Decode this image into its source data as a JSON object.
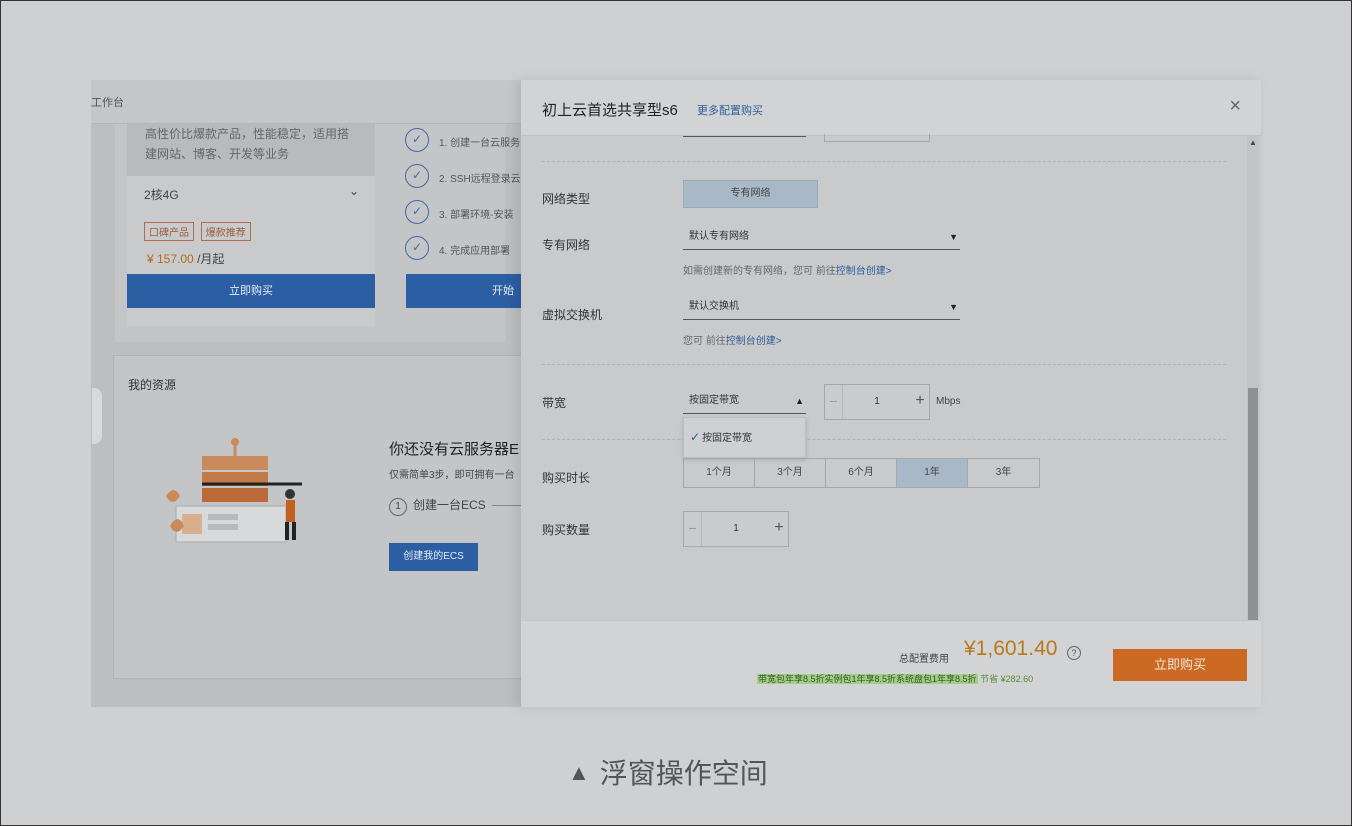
{
  "background": {
    "workspace_label": "工作台",
    "product": {
      "description_line1": "高性价比爆款产品，性能稳定，适用搭",
      "description_line2": "建网站、博客、开发等业务",
      "spec": "2核4G",
      "tags": [
        "口碑产品",
        "爆款推荐"
      ],
      "price": "¥ 157.00",
      "price_unit": "/月起",
      "buy_label": "立即购买"
    },
    "steps": [
      "1. 创建一台云服务",
      "2. SSH远程登录云",
      "3. 部署环境-安装",
      "4. 完成应用部署"
    ],
    "start_label": "开始",
    "resources": {
      "title": "我的资源",
      "empty_title": "你还没有云服务器E",
      "empty_sub": "仅需简单3步，即可拥有一台",
      "step1": "创建一台ECS",
      "step1_num": "1",
      "create_label": "创建我的ECS"
    }
  },
  "drawer": {
    "title": "初上云首选共享型s6",
    "more_link": "更多配置购买",
    "close_icon": "×",
    "network_type": {
      "label": "网络类型",
      "value": "专有网络"
    },
    "vpc": {
      "label": "专有网络",
      "value": "默认专有网络",
      "hint": "如需创建新的专有网络，您可 前往",
      "hint_link": "控制台创建>"
    },
    "vswitch": {
      "label": "虚拟交换机",
      "value": "默认交换机",
      "hint": "您可 前往",
      "hint_link": "控制台创建>"
    },
    "bandwidth": {
      "label": "带宽",
      "mode": "按固定带宽",
      "dropdown_option": "按固定带宽",
      "value": "1",
      "unit": "Mbps"
    },
    "duration": {
      "label": "购买时长",
      "options": [
        "1个月",
        "3个月",
        "6个月",
        "1年",
        "3年"
      ],
      "selected": "1年"
    },
    "quantity": {
      "label": "购买数量",
      "value": "1"
    },
    "footer": {
      "total_label": "总配置费用",
      "total": "¥1,601.40",
      "help_icon": "?",
      "discount": "带宽包年享8.5折实例包1年享8.5折系统盘包1年享8.5折",
      "savings": "节省 ¥282.60",
      "buy_label": "立即购买"
    }
  },
  "caption": "浮窗操作空间"
}
